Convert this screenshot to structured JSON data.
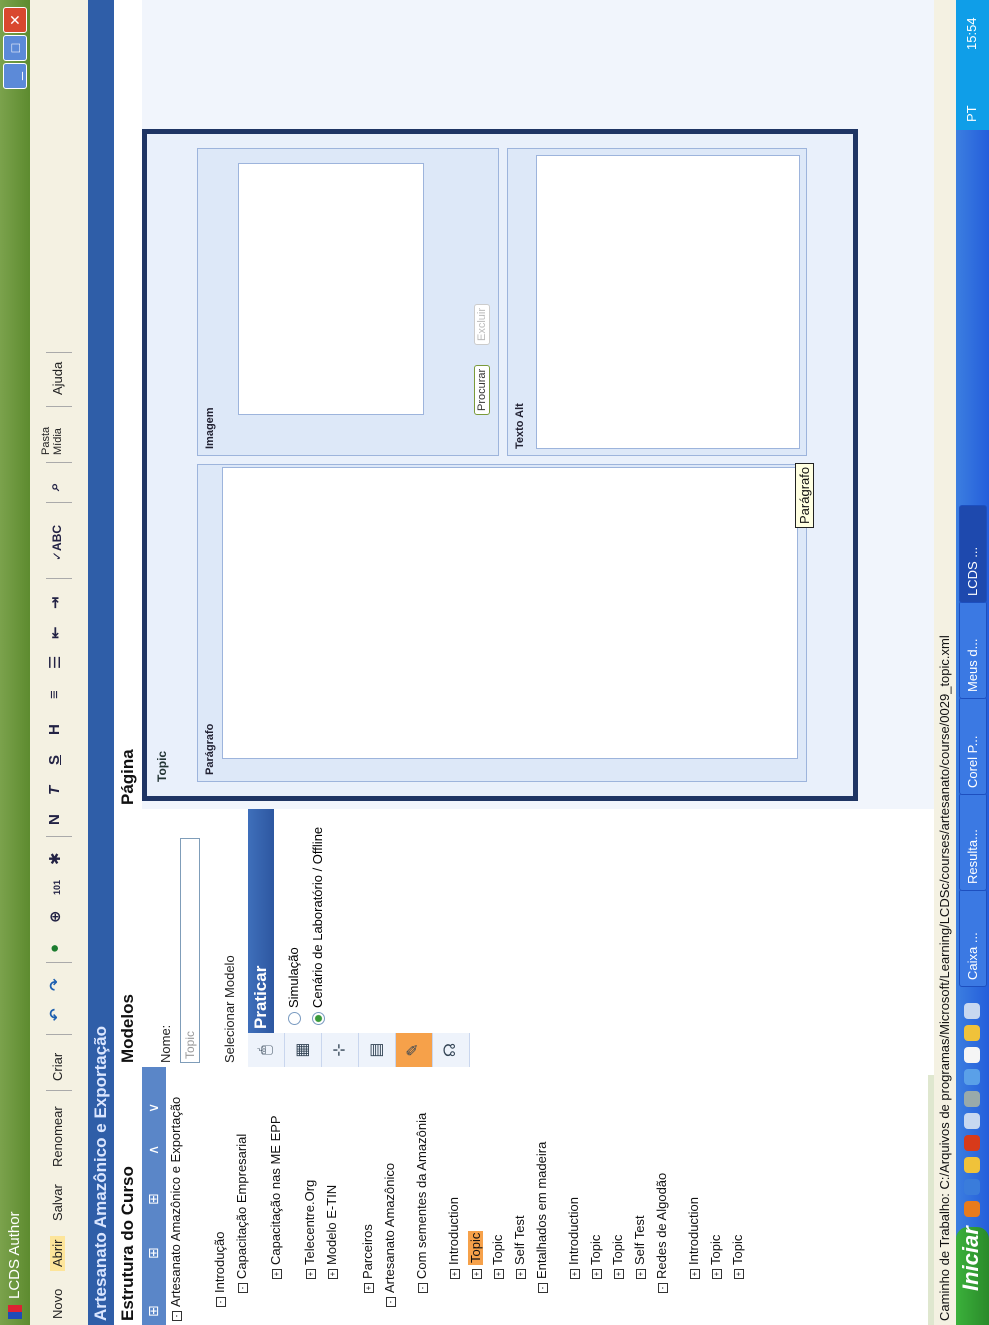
{
  "window": {
    "title": "LCDS Author"
  },
  "menu": {
    "novo": "Novo",
    "abrir": "Abrir",
    "salvar": "Salvar",
    "renomear": "Renomear",
    "criar": "Criar",
    "pasta_midia": "Pasta Mídia",
    "ajuda": "Ajuda"
  },
  "course": {
    "title": "Artesanato Amazônico e Exportação"
  },
  "tree": {
    "title": "Estrutura do Curso",
    "nodes": [
      "Artesanato Amazônico e Exportação",
      "Introdução",
      "Capacitação Empresarial",
      "Capacitação nas ME EPP",
      "Telecentre.Org",
      "Modelo E-TIN",
      "Parceiros",
      "Artesanato Amazônico",
      "Com sementes da Amazônia",
      "Introduction",
      "Topic",
      "Topic",
      "Self Test",
      "Entalhados em madeira",
      "Introduction",
      "Topic",
      "Topic",
      "Self Test",
      "Redes de Algodão",
      "Introduction",
      "Topic",
      "Topic"
    ]
  },
  "models": {
    "title": "Modelos",
    "nome_label": "Nome:",
    "nome_value": "Topic",
    "select_label": "Selecionar Modelo",
    "praticar": "Praticar",
    "option_simulacao": "Simulação",
    "option_cenario": "Cenário de Laboratório / Offline"
  },
  "page": {
    "title": "Página",
    "topic": "Topic",
    "paragrafo_label": "Parágrafo",
    "imagem_label": "Imagem",
    "procurar": "Procurar",
    "excluir": "Excluir",
    "texto_alt_label": "Texto Alt",
    "tooltip": "Parágrafo"
  },
  "path": "Caminho de Trabalho: C:/Arquivos de programas/Microsoft/Learning/LCDSc/courses/artesanato/course/0029_topic.xml",
  "taskbar": {
    "start": "Iniciar",
    "tasks": [
      "Caixa ...",
      "Resulta...",
      "Corel P...",
      "Meus d...",
      "LCDS ..."
    ],
    "lang": "PT",
    "clock": "15:54"
  },
  "colors": {
    "accent": "#2f5ea8",
    "selected": "#f6a14a",
    "frame": "#1f3564"
  }
}
